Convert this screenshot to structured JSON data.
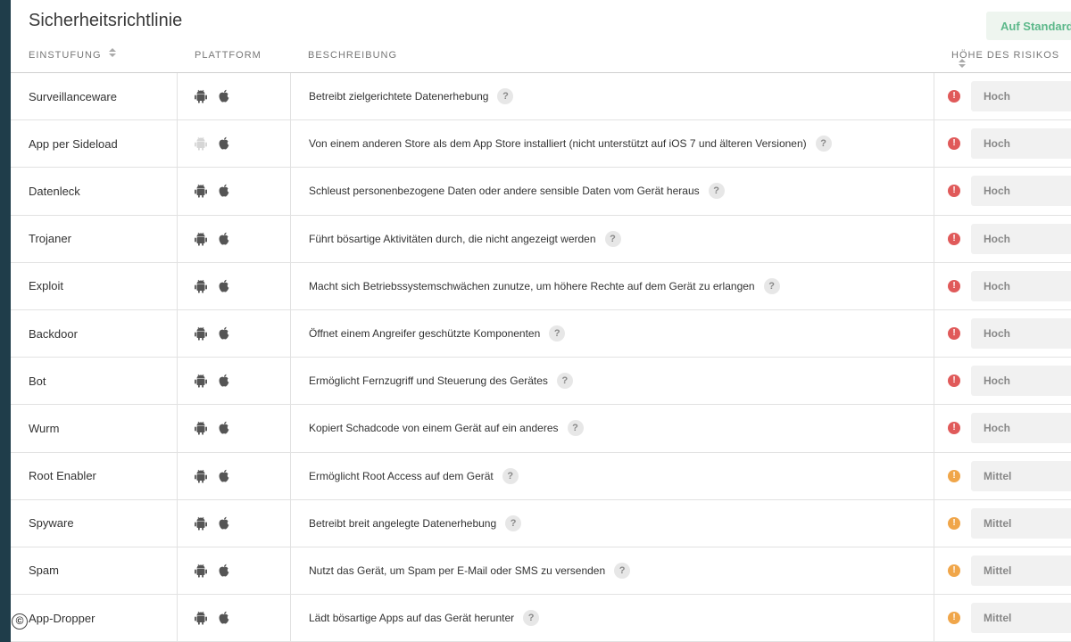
{
  "page": {
    "title": "Sicherheitsrichtlinie",
    "reset_label": "Auf Standard"
  },
  "columns": {
    "classification": "EINSTUFUNG",
    "platform": "PLATTFORM",
    "description": "BESCHREIBUNG",
    "risk": "HÖHE DES RISIKOS"
  },
  "colors": {
    "high": "#e05a5a",
    "medium": "#f0a64a",
    "accent": "#5cb88a",
    "sidebar": "#1f3d4a"
  },
  "rows": [
    {
      "name": "Surveillanceware",
      "description": "Betreibt zielgerichtete Datenerhebung",
      "risk": "Hoch",
      "level": "high",
      "android": true
    },
    {
      "name": "App per Sideload",
      "description": "Von einem anderen Store als dem App Store installiert (nicht unterstützt auf iOS 7 und älteren Versionen)",
      "risk": "Hoch",
      "level": "high",
      "android": false
    },
    {
      "name": "Datenleck",
      "description": "Schleust personenbezogene Daten oder andere sensible Daten vom Gerät heraus",
      "risk": "Hoch",
      "level": "high",
      "android": true
    },
    {
      "name": "Trojaner",
      "description": "Führt bösartige Aktivitäten durch, die nicht angezeigt werden",
      "risk": "Hoch",
      "level": "high",
      "android": true
    },
    {
      "name": "Exploit",
      "description": "Macht sich Betriebssystemschwächen zunutze, um höhere Rechte auf dem Gerät zu erlangen",
      "risk": "Hoch",
      "level": "high",
      "android": true
    },
    {
      "name": "Backdoor",
      "description": "Öffnet einem Angreifer geschützte Komponenten",
      "risk": "Hoch",
      "level": "high",
      "android": true
    },
    {
      "name": "Bot",
      "description": "Ermöglicht Fernzugriff und Steuerung des Gerätes",
      "risk": "Hoch",
      "level": "high",
      "android": true
    },
    {
      "name": "Wurm",
      "description": "Kopiert Schadcode von einem Gerät auf ein anderes",
      "risk": "Hoch",
      "level": "high",
      "android": true
    },
    {
      "name": "Root Enabler",
      "description": "Ermöglicht Root Access auf dem Gerät",
      "risk": "Mittel",
      "level": "medium",
      "android": true
    },
    {
      "name": "Spyware",
      "description": "Betreibt breit angelegte Datenerhebung",
      "risk": "Mittel",
      "level": "medium",
      "android": true
    },
    {
      "name": "Spam",
      "description": "Nutzt das Gerät, um Spam per E-Mail oder SMS zu versenden",
      "risk": "Mittel",
      "level": "medium",
      "android": true
    },
    {
      "name": "App-Dropper",
      "description": "Lädt bösartige Apps auf das Gerät herunter",
      "risk": "Mittel",
      "level": "medium",
      "android": true
    }
  ],
  "icons": {
    "android": "android-icon",
    "apple": "apple-icon",
    "help": "help-icon",
    "risk": "exclamation-icon",
    "sort": "sort-icon"
  },
  "help_glyph": "?",
  "risk_glyph": "!",
  "copyright_glyph": "©"
}
